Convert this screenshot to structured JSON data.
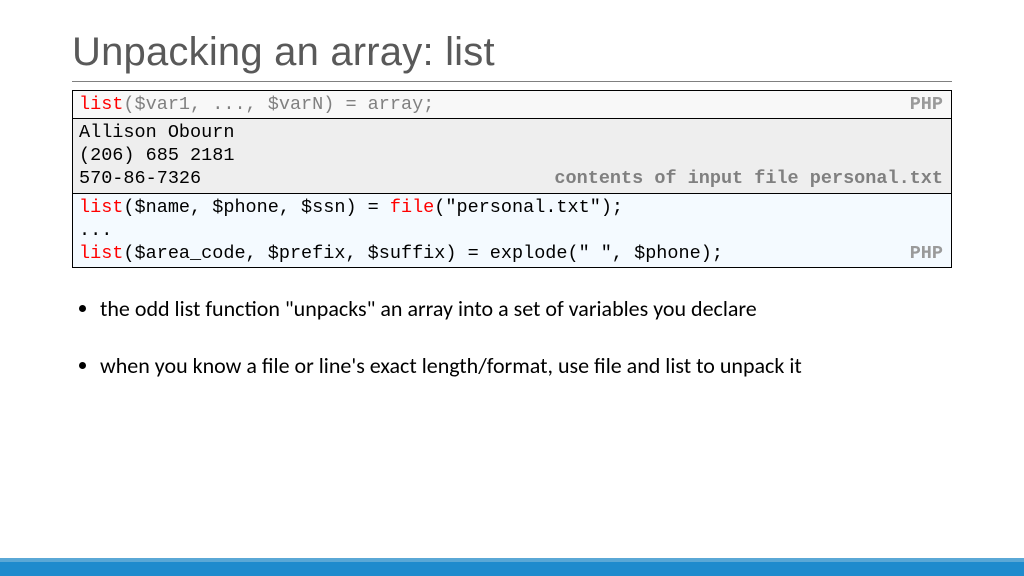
{
  "title": "Unpacking an array: list",
  "box1": {
    "code_prefix": "list",
    "code_rest": "($var1, ..., $varN) = array;",
    "lang": "PHP"
  },
  "box2": {
    "line1": "Allison Obourn",
    "line2": "(206) 685 2181",
    "line3": "570-86-7326",
    "caption": "contents of input file personal.txt"
  },
  "box3": {
    "l1_kw": "list",
    "l1_rest_a": "($name, $phone, $ssn) = ",
    "l1_fn": "file",
    "l1_rest_b": "(\"personal.txt\");",
    "l2": "...",
    "l3_kw": "list",
    "l3_rest": "($area_code, $prefix, $suffix) = explode(\" \", $phone);",
    "lang": "PHP"
  },
  "bullets": {
    "b1": "the odd list function \"unpacks\" an array into a set of variables you declare",
    "b2": "when you know a file or line's exact length/format, use file and list to unpack it"
  }
}
